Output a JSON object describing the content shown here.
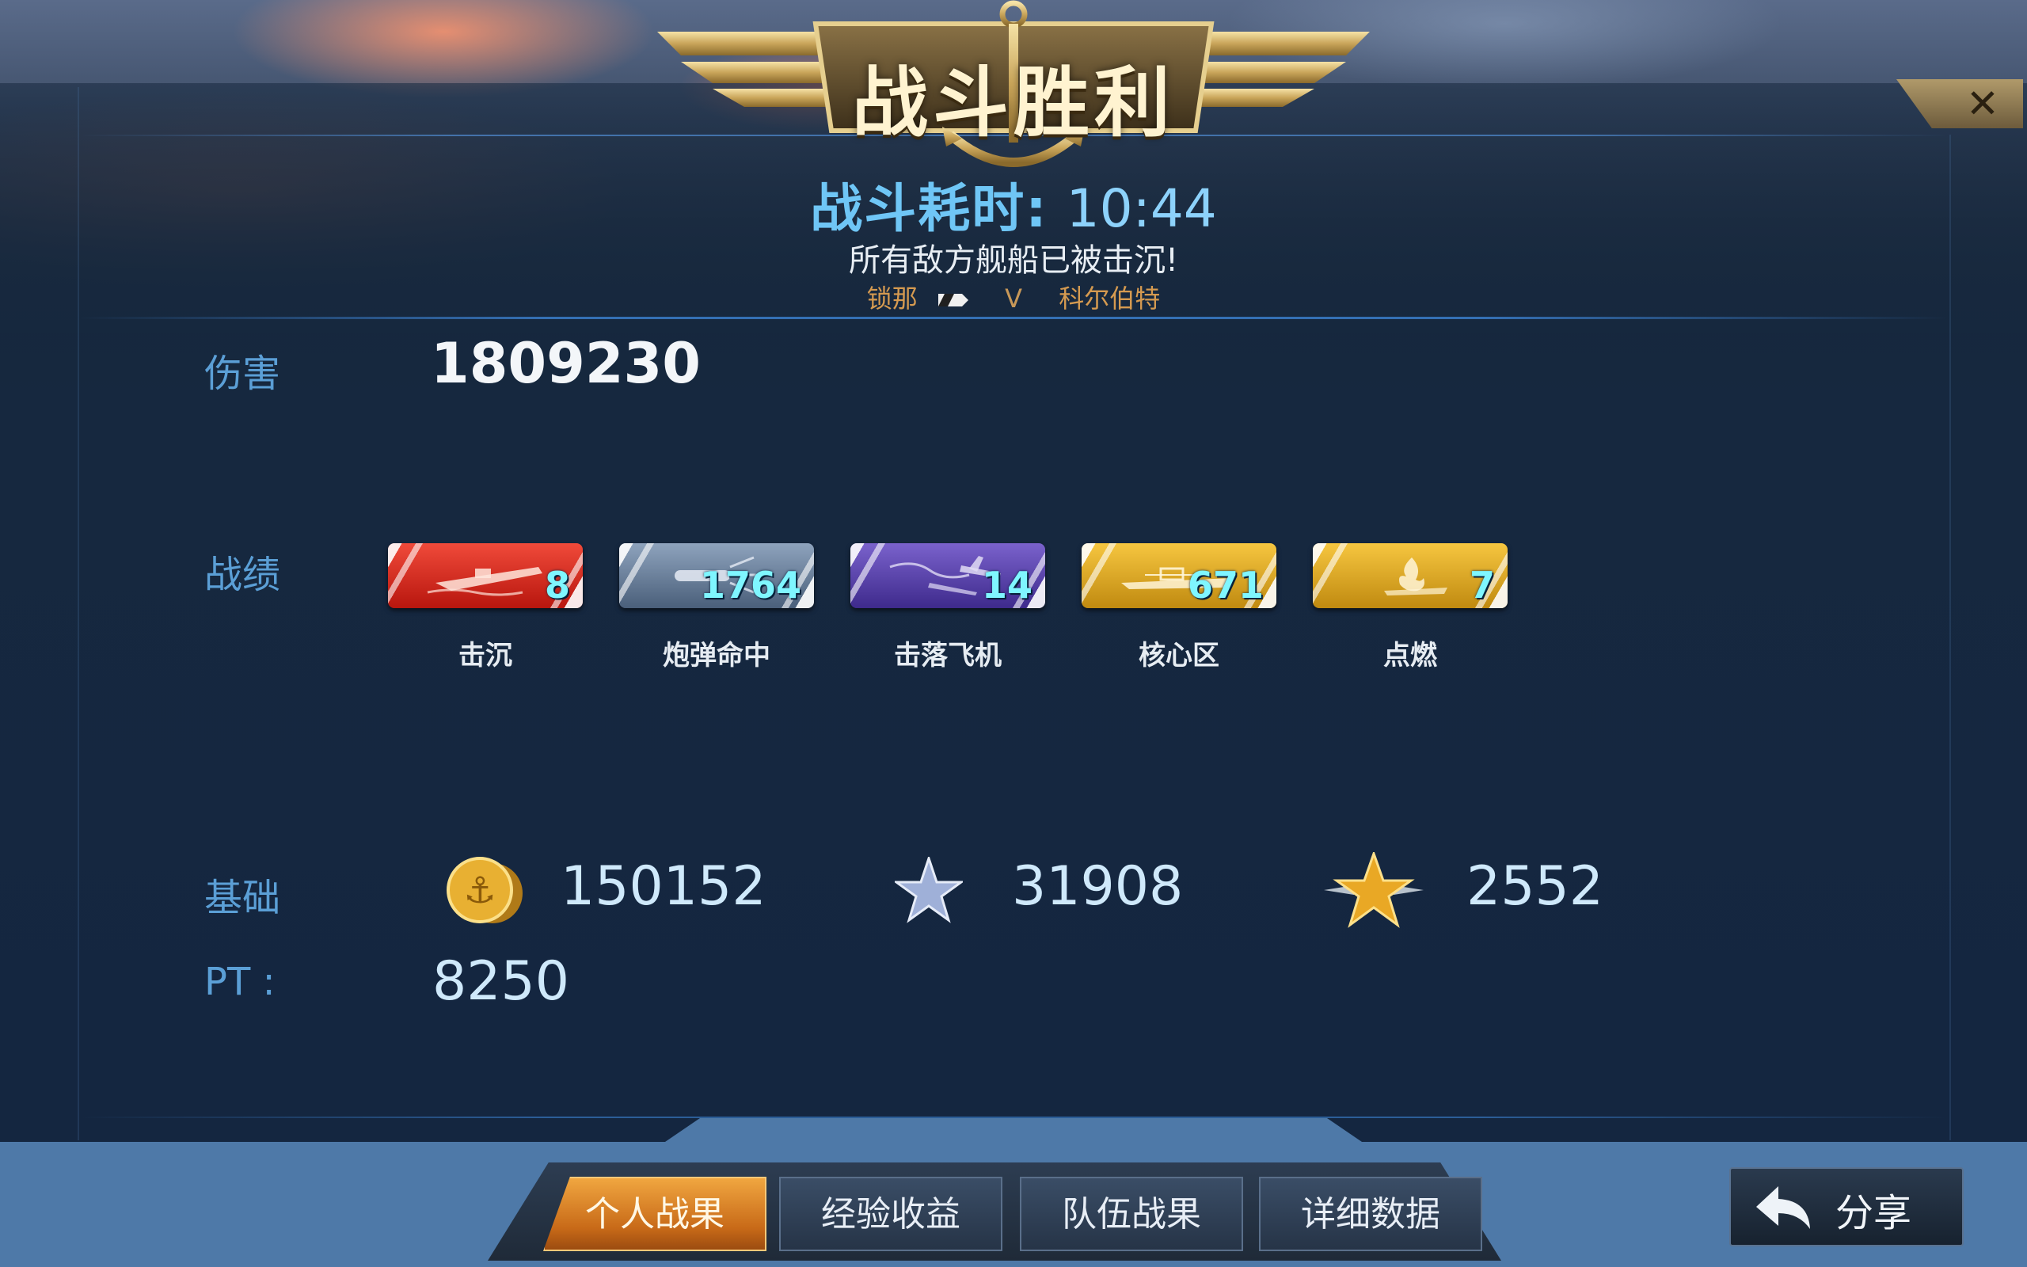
{
  "header": {
    "title": "战斗胜利",
    "duration_label": "战斗耗时:",
    "duration_value": "10:44",
    "result_text": "所有敌方舰船已被击沉!",
    "player_left": "锁那",
    "vs": "V",
    "player_right": "科尔伯特"
  },
  "damage": {
    "label": "伤害",
    "value": "1809230"
  },
  "record": {
    "label": "战绩",
    "medals": [
      {
        "label": "击沉",
        "count": "8",
        "color": "#d42a1e",
        "icon": "sink-icon"
      },
      {
        "label": "炮弹命中",
        "count": "1764",
        "color": "#5f7590",
        "icon": "shell-hit-icon"
      },
      {
        "label": "击落飞机",
        "count": "14",
        "color": "#5a3fa8",
        "icon": "plane-down-icon"
      },
      {
        "label": "核心区",
        "count": "671",
        "color": "#e0a418",
        "icon": "citadel-icon"
      },
      {
        "label": "点燃",
        "count": "7",
        "color": "#e0a418",
        "icon": "fire-icon"
      }
    ]
  },
  "base": {
    "label": "基础",
    "coins": "150152",
    "silver_star": "31908",
    "gold_star": "2552"
  },
  "pt": {
    "label": "PT :",
    "value": "8250"
  },
  "tabs": [
    {
      "label": "个人战果",
      "active": true
    },
    {
      "label": "经验收益",
      "active": false
    },
    {
      "label": "队伍战果",
      "active": false
    },
    {
      "label": "详细数据",
      "active": false
    }
  ],
  "share": {
    "label": "分享"
  },
  "colors": {
    "accent_blue": "#5b9fd6",
    "gold": "#d59a50",
    "tab_active": "#e08a2a"
  }
}
